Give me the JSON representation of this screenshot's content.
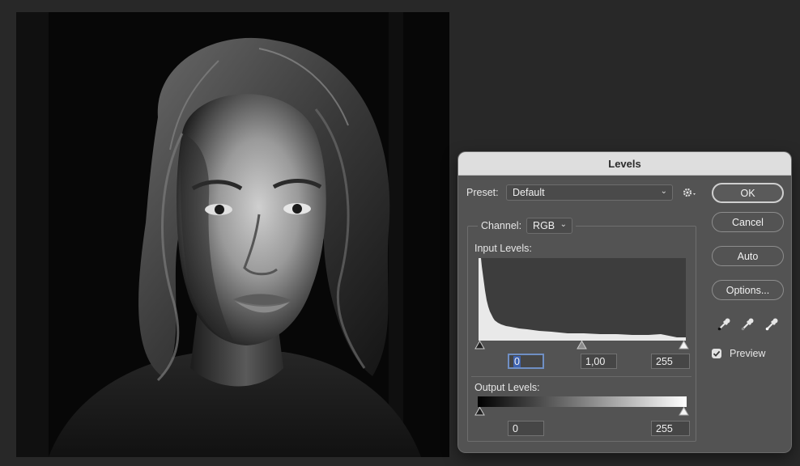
{
  "dialog": {
    "title": "Levels",
    "preset_label": "Preset:",
    "preset_value": "Default",
    "channel_label": "Channel:",
    "channel_value": "RGB",
    "input_levels_label": "Input Levels:",
    "input_black": "0",
    "input_gamma": "1,00",
    "input_white": "255",
    "output_levels_label": "Output Levels:",
    "output_black": "0",
    "output_white": "255",
    "buttons": {
      "ok": "OK",
      "cancel": "Cancel",
      "auto": "Auto",
      "options": "Options..."
    },
    "preview_label": "Preview",
    "preview_checked": true
  },
  "icons": {
    "settings": "gear-icon",
    "black_point": "eyedropper-black-icon",
    "gray_point": "eyedropper-gray-icon",
    "white_point": "eyedropper-white-icon"
  },
  "colors": {
    "app_background": "#282828",
    "dialog_background": "#535353",
    "titlebar": "#dedede",
    "focus_highlight": "#3e63b0"
  }
}
